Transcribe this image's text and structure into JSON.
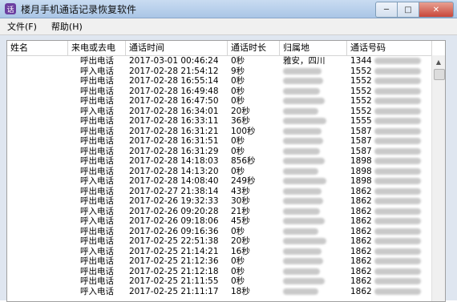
{
  "app": {
    "title": "楼月手机通话记录恢复软件",
    "icon_text": "话"
  },
  "window_controls": {
    "minimize": "─",
    "maximize": "□",
    "close": "✕"
  },
  "menu": [
    "文件(F)",
    "帮助(H)"
  ],
  "table": {
    "columns": [
      "姓名",
      "来电或去电",
      "通话时间",
      "通话时长",
      "归属地",
      "通话号码"
    ],
    "rows": [
      {
        "name": "",
        "direction": "呼出电话",
        "time": "2017-03-01 00:46:24",
        "duration": "0秒",
        "location": "雅安，四川",
        "number": "1344"
      },
      {
        "name": "",
        "direction": "呼入电话",
        "time": "2017-02-28 21:54:12",
        "duration": "9秒",
        "location": "",
        "number": "1552"
      },
      {
        "name": "",
        "direction": "呼出电话",
        "time": "2017-02-28 16:55:14",
        "duration": "0秒",
        "location": "",
        "number": "1552"
      },
      {
        "name": "",
        "direction": "呼出电话",
        "time": "2017-02-28 16:49:48",
        "duration": "0秒",
        "location": "",
        "number": "1552"
      },
      {
        "name": "",
        "direction": "呼出电话",
        "time": "2017-02-28 16:47:50",
        "duration": "0秒",
        "location": "",
        "number": "1552"
      },
      {
        "name": "",
        "direction": "呼入电话",
        "time": "2017-02-28 16:34:01",
        "duration": "20秒",
        "location": "",
        "number": "1552"
      },
      {
        "name": "",
        "direction": "呼出电话",
        "time": "2017-02-28 16:33:11",
        "duration": "36秒",
        "location": "",
        "number": "1555"
      },
      {
        "name": "",
        "direction": "呼出电话",
        "time": "2017-02-28 16:31:21",
        "duration": "100秒",
        "location": "",
        "number": "1587"
      },
      {
        "name": "",
        "direction": "呼出电话",
        "time": "2017-02-28 16:31:51",
        "duration": "0秒",
        "location": "",
        "number": "1587"
      },
      {
        "name": "",
        "direction": "呼出电话",
        "time": "2017-02-28 16:31:29",
        "duration": "0秒",
        "location": "",
        "number": "1587"
      },
      {
        "name": "",
        "direction": "呼出电话",
        "time": "2017-02-28 14:18:03",
        "duration": "856秒",
        "location": "",
        "number": "1898"
      },
      {
        "name": "",
        "direction": "呼出电话",
        "time": "2017-02-28 14:13:20",
        "duration": "0秒",
        "location": "",
        "number": "1898"
      },
      {
        "name": "",
        "direction": "呼入电话",
        "time": "2017-02-28 14:08:40",
        "duration": "249秒",
        "location": "",
        "number": "1898"
      },
      {
        "name": "",
        "direction": "呼出电话",
        "time": "2017-02-27 21:38:14",
        "duration": "43秒",
        "location": "",
        "number": "1862"
      },
      {
        "name": "",
        "direction": "呼出电话",
        "time": "2017-02-26 19:32:33",
        "duration": "30秒",
        "location": "",
        "number": "1862"
      },
      {
        "name": "",
        "direction": "呼入电话",
        "time": "2017-02-26 09:20:28",
        "duration": "21秒",
        "location": "",
        "number": "1862"
      },
      {
        "name": "",
        "direction": "呼入电话",
        "time": "2017-02-26 09:18:06",
        "duration": "45秒",
        "location": "",
        "number": "1862"
      },
      {
        "name": "",
        "direction": "呼出电话",
        "time": "2017-02-26 09:16:36",
        "duration": "0秒",
        "location": "",
        "number": "1862"
      },
      {
        "name": "",
        "direction": "呼出电话",
        "time": "2017-02-25 22:51:38",
        "duration": "20秒",
        "location": "",
        "number": "1862"
      },
      {
        "name": "",
        "direction": "呼入电话",
        "time": "2017-02-25 21:14:21",
        "duration": "16秒",
        "location": "",
        "number": "1862"
      },
      {
        "name": "",
        "direction": "呼出电话",
        "time": "2017-02-25 21:12:36",
        "duration": "0秒",
        "location": "",
        "number": "1862"
      },
      {
        "name": "",
        "direction": "呼出电话",
        "time": "2017-02-25 21:12:18",
        "duration": "0秒",
        "location": "",
        "number": "1862"
      },
      {
        "name": "",
        "direction": "呼出电话",
        "time": "2017-02-25 21:11:55",
        "duration": "0秒",
        "location": "",
        "number": "1862"
      },
      {
        "name": "",
        "direction": "呼入电话",
        "time": "2017-02-25 21:11:17",
        "duration": "18秒",
        "location": "",
        "number": "1862"
      }
    ]
  }
}
